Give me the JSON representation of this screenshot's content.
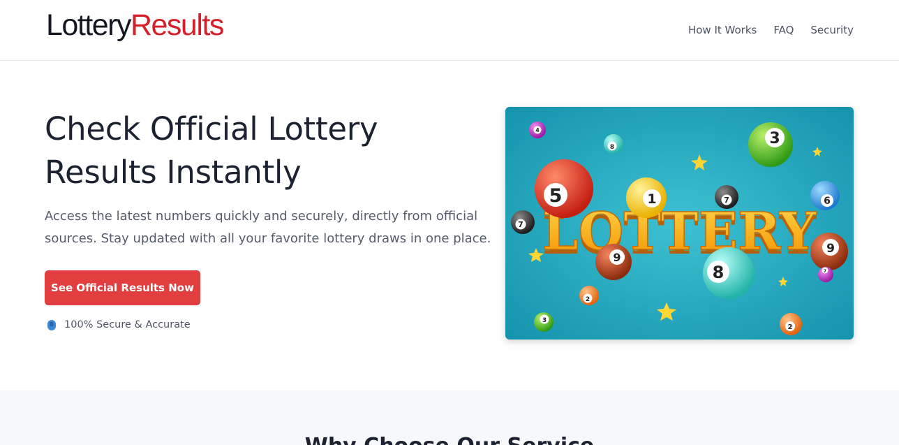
{
  "header": {
    "logo_part1": "Lottery",
    "logo_part2": "Results",
    "nav": [
      "How It Works",
      "FAQ",
      "Security"
    ]
  },
  "hero": {
    "title_line1": "Check Official Lottery",
    "title_line2": "Results Instantly",
    "subtitle_line1": "Access the latest numbers quickly and securely, directly from official",
    "subtitle_line2": "sources. Stay updated with all your favorite lottery draws in one place.",
    "cta_label": "See Official Results Now",
    "secure_label": "100% Secure & Accurate",
    "image": {
      "word": "LOTTERY",
      "balls": [
        "4",
        "8",
        "3",
        "5",
        "1",
        "7",
        "6",
        "7",
        "9",
        "8",
        "9",
        "2",
        "7",
        "3",
        "2"
      ]
    }
  },
  "section2": {
    "title": "Why Choose Our Service"
  },
  "colors": {
    "brand_red": "#d4202b",
    "cta_red": "#e23d3f",
    "image_bg": "#1fa2b9",
    "lettering": "#ffb21a"
  }
}
